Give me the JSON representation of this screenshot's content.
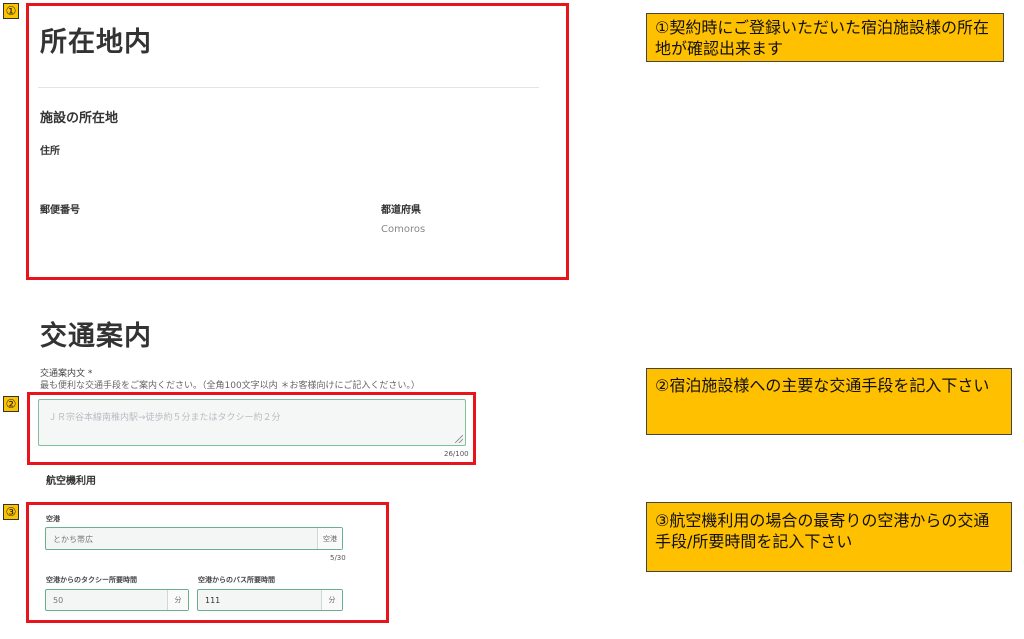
{
  "section1": {
    "marker": "①",
    "title": "所在地内",
    "subtitle": "施設の所在地",
    "address_label": "住所",
    "postal_label": "郵便番号",
    "prefecture_label": "都道府県",
    "prefecture_value": "Comoros"
  },
  "section2": {
    "marker": "②",
    "title": "交通案内",
    "field_label": "交通案内文 *",
    "field_help": "最も便利な交通手段をご案内ください。（全角100文字以内 ＊お客様向けにご記入ください。）",
    "textarea_value": "ＪＲ宗谷本線南稚内駅→徒歩約５分またはタクシー約２分",
    "counter": "26/100"
  },
  "section3": {
    "marker": "③",
    "heading": "航空機利用",
    "airport_label": "空港",
    "airport_value": "とかち帯広",
    "airport_unit": "空港",
    "airport_counter": "5/30",
    "taxi_label": "空港からのタクシー所要時間",
    "taxi_value": "50",
    "taxi_unit": "分",
    "bus_label": "空港からのバス所要時間",
    "bus_value": "111",
    "bus_unit": "分"
  },
  "callouts": {
    "c1": "①契約時にご登録いただいた宿泊施設様の所在地が確認出来ます",
    "c2": "②宿泊施設様への主要な交通手段を記入下さい",
    "c3": "③航空機利用の場合の最寄りの空港からの交通手段/所要時間を記入下さい"
  }
}
